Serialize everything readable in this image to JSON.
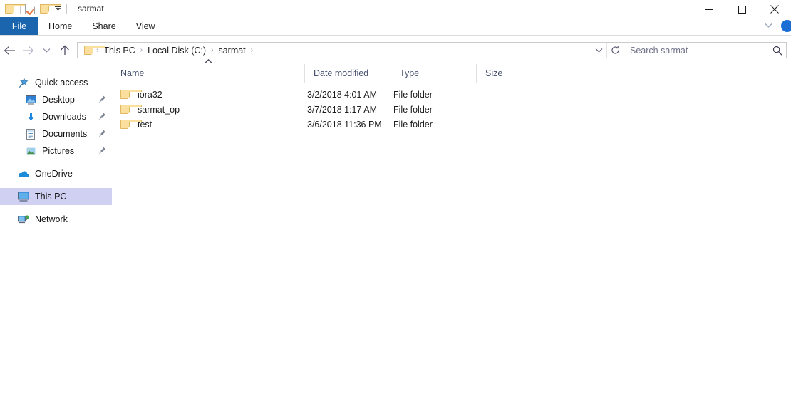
{
  "window": {
    "title": "sarmat",
    "quick_access": [
      {
        "name": "folder-icon",
        "label": "Folder"
      },
      {
        "name": "properties-icon",
        "label": "Properties"
      },
      {
        "name": "new-folder-icon",
        "label": "New folder"
      },
      {
        "name": "customize-caret-icon",
        "label": "Customize Quick Access Toolbar"
      }
    ],
    "controls": {
      "minimize": "Minimize",
      "maximize": "Maximize",
      "close": "Close"
    }
  },
  "ribbon": {
    "tabs": [
      {
        "label": "File",
        "active": true
      },
      {
        "label": "Home",
        "active": false
      },
      {
        "label": "Share",
        "active": false
      },
      {
        "label": "View",
        "active": false
      }
    ],
    "expand_label": "Expand the Ribbon",
    "help_label": "Help"
  },
  "nav": {
    "back": "Back",
    "forward": "Forward",
    "recent": "Recent locations",
    "up": "Up one level",
    "breadcrumbs": [
      {
        "label": "This PC"
      },
      {
        "label": "Local Disk (C:)"
      },
      {
        "label": "sarmat"
      }
    ],
    "separator": "›",
    "history_caret": "Previous locations",
    "refresh": "Refresh"
  },
  "search": {
    "placeholder": "Search sarmat",
    "value": "",
    "icon": "search-icon"
  },
  "sidebar": {
    "items": [
      {
        "label": "Quick access",
        "icon": "star-pin-icon",
        "level": 0,
        "pinned": false,
        "selected": false
      },
      {
        "label": "Desktop",
        "icon": "desktop-icon",
        "level": 1,
        "pinned": true,
        "selected": false
      },
      {
        "label": "Downloads",
        "icon": "downloads-icon",
        "level": 1,
        "pinned": true,
        "selected": false
      },
      {
        "label": "Documents",
        "icon": "documents-icon",
        "level": 1,
        "pinned": true,
        "selected": false
      },
      {
        "label": "Pictures",
        "icon": "pictures-icon",
        "level": 1,
        "pinned": true,
        "selected": false
      },
      {
        "label": "OneDrive",
        "icon": "onedrive-icon",
        "level": 0,
        "pinned": false,
        "selected": false
      },
      {
        "label": "This PC",
        "icon": "this-pc-icon",
        "level": 0,
        "pinned": false,
        "selected": true
      },
      {
        "label": "Network",
        "icon": "network-icon",
        "level": 0,
        "pinned": false,
        "selected": false
      }
    ],
    "pin_glyph": "📌"
  },
  "file_list": {
    "columns": [
      {
        "label": "Name",
        "sorted": true,
        "sort_direction": "asc"
      },
      {
        "label": "Date modified",
        "sorted": false
      },
      {
        "label": "Type",
        "sorted": false
      },
      {
        "label": "Size",
        "sorted": false
      }
    ],
    "sort_glyph": "˄",
    "rows": [
      {
        "name": "iora32",
        "date_modified": "3/2/2018 4:01 AM",
        "type": "File folder",
        "size": "",
        "icon": "folder-icon"
      },
      {
        "name": "sarmat_op",
        "date_modified": "3/7/2018 1:17 AM",
        "type": "File folder",
        "size": "",
        "icon": "folder-icon"
      },
      {
        "name": "test",
        "date_modified": "3/6/2018 11:36 PM",
        "type": "File folder",
        "size": "",
        "icon": "folder-icon"
      }
    ]
  },
  "colors": {
    "accent": "#1b65ae",
    "selection": "#cfd0f2",
    "folder": "#fadf9f",
    "header_text": "#46506e",
    "help_button": "#1b6fd4"
  }
}
